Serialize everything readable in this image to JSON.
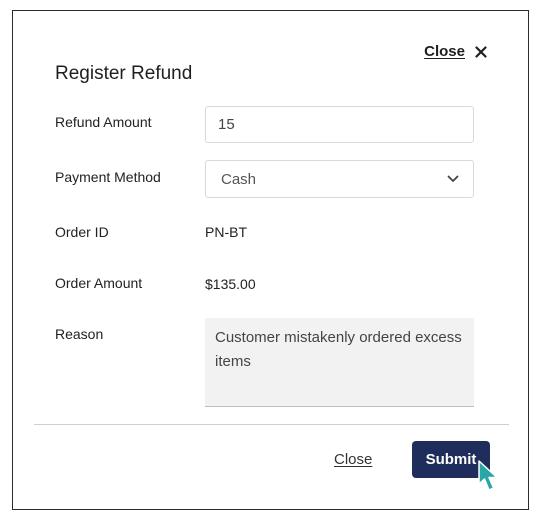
{
  "dialog": {
    "title": "Register Refund",
    "top_close_label": "Close"
  },
  "form": {
    "refund_amount": {
      "label": "Refund Amount",
      "value": "15"
    },
    "payment_method": {
      "label": "Payment Method",
      "selected": "Cash"
    },
    "order_id": {
      "label": "Order ID",
      "value": "PN-BT"
    },
    "order_amount": {
      "label": "Order Amount",
      "value": "$135.00"
    },
    "reason": {
      "label": "Reason",
      "value": "Customer mistakenly ordered excess items"
    }
  },
  "footer": {
    "close_label": "Close",
    "submit_label": "Submit"
  },
  "colors": {
    "primary_button": "#1f2d5c",
    "cursor": "#2aa6a6"
  },
  "icons": {
    "close": "close-icon",
    "dropdown": "chevron-down-icon",
    "pointer": "cursor-icon"
  }
}
